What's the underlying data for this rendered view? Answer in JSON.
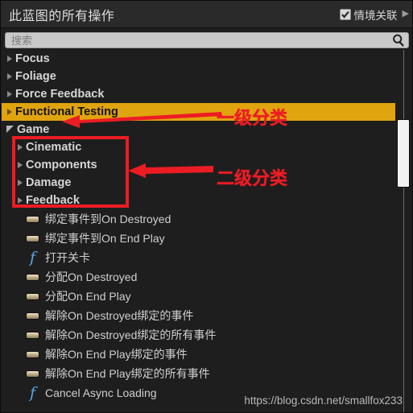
{
  "header": {
    "title": "此蓝图的所有操作",
    "context_checkbox": {
      "label": "情境关联",
      "checked": true,
      "icon": "checkmark-icon"
    },
    "expand_chevron": "▶"
  },
  "search": {
    "value": "",
    "placeholder": "搜索",
    "icon": "search-icon"
  },
  "tree": {
    "items": [
      {
        "label": "Focus",
        "level": 1,
        "state": "collapsed",
        "icon": "triangle-right-icon",
        "highlighted": false
      },
      {
        "label": "Foliage",
        "level": 1,
        "state": "collapsed",
        "icon": "triangle-right-icon",
        "highlighted": false
      },
      {
        "label": "Force Feedback",
        "level": 1,
        "state": "collapsed",
        "icon": "triangle-right-icon",
        "highlighted": false
      },
      {
        "label": "Functional Testing",
        "level": 1,
        "state": "collapsed",
        "icon": "triangle-right-icon",
        "highlighted": true
      },
      {
        "label": "Game",
        "level": 1,
        "state": "expanded",
        "icon": "triangle-down-icon",
        "highlighted": false
      },
      {
        "label": "Cinematic",
        "level": 2,
        "state": "collapsed",
        "icon": "triangle-right-icon",
        "highlighted": false
      },
      {
        "label": "Components",
        "level": 2,
        "state": "collapsed",
        "icon": "triangle-right-icon",
        "highlighted": false
      },
      {
        "label": "Damage",
        "level": 2,
        "state": "collapsed",
        "icon": "triangle-right-icon",
        "highlighted": false
      },
      {
        "label": "Feedback",
        "level": 2,
        "state": "collapsed",
        "icon": "triangle-right-icon",
        "highlighted": false
      },
      {
        "label": "绑定事件到On Destroyed",
        "level": 3,
        "state": "leaf",
        "icon": "event-node-icon",
        "highlighted": false
      },
      {
        "label": "绑定事件到On End Play",
        "level": 3,
        "state": "leaf",
        "icon": "event-node-icon",
        "highlighted": false
      },
      {
        "label": "打开关卡",
        "level": 3,
        "state": "leaf",
        "icon": "function-node-icon",
        "highlighted": false
      },
      {
        "label": "分配On Destroyed",
        "level": 3,
        "state": "leaf",
        "icon": "event-node-icon",
        "highlighted": false
      },
      {
        "label": "分配On End Play",
        "level": 3,
        "state": "leaf",
        "icon": "event-node-icon",
        "highlighted": false
      },
      {
        "label": "解除On Destroyed绑定的事件",
        "level": 3,
        "state": "leaf",
        "icon": "event-node-icon",
        "highlighted": false
      },
      {
        "label": "解除On Destroyed绑定的所有事件",
        "level": 3,
        "state": "leaf",
        "icon": "event-node-icon",
        "highlighted": false
      },
      {
        "label": "解除On End Play绑定的事件",
        "level": 3,
        "state": "leaf",
        "icon": "event-node-icon",
        "highlighted": false
      },
      {
        "label": "解除On End Play绑定的所有事件",
        "level": 3,
        "state": "leaf",
        "icon": "event-node-icon",
        "highlighted": false
      },
      {
        "label": "Cancel Async Loading",
        "level": 3,
        "state": "leaf",
        "icon": "function-node-icon",
        "highlighted": false
      }
    ]
  },
  "annotations": {
    "primary_category": "一级分类",
    "secondary_category": "二级分类",
    "color": "#ec1c24"
  },
  "scrollbar": {
    "thumb_top_pct": 19,
    "thumb_height_pct": 19
  },
  "watermark": "https://blog.csdn.net/smallfox233",
  "colors": {
    "highlight": "#e0a40f",
    "background": "#1e1e1e",
    "header": "#2a2a2a",
    "text": "#d6d6d6",
    "function_icon": "#5aa7e8",
    "annotation": "#ec1c24"
  }
}
